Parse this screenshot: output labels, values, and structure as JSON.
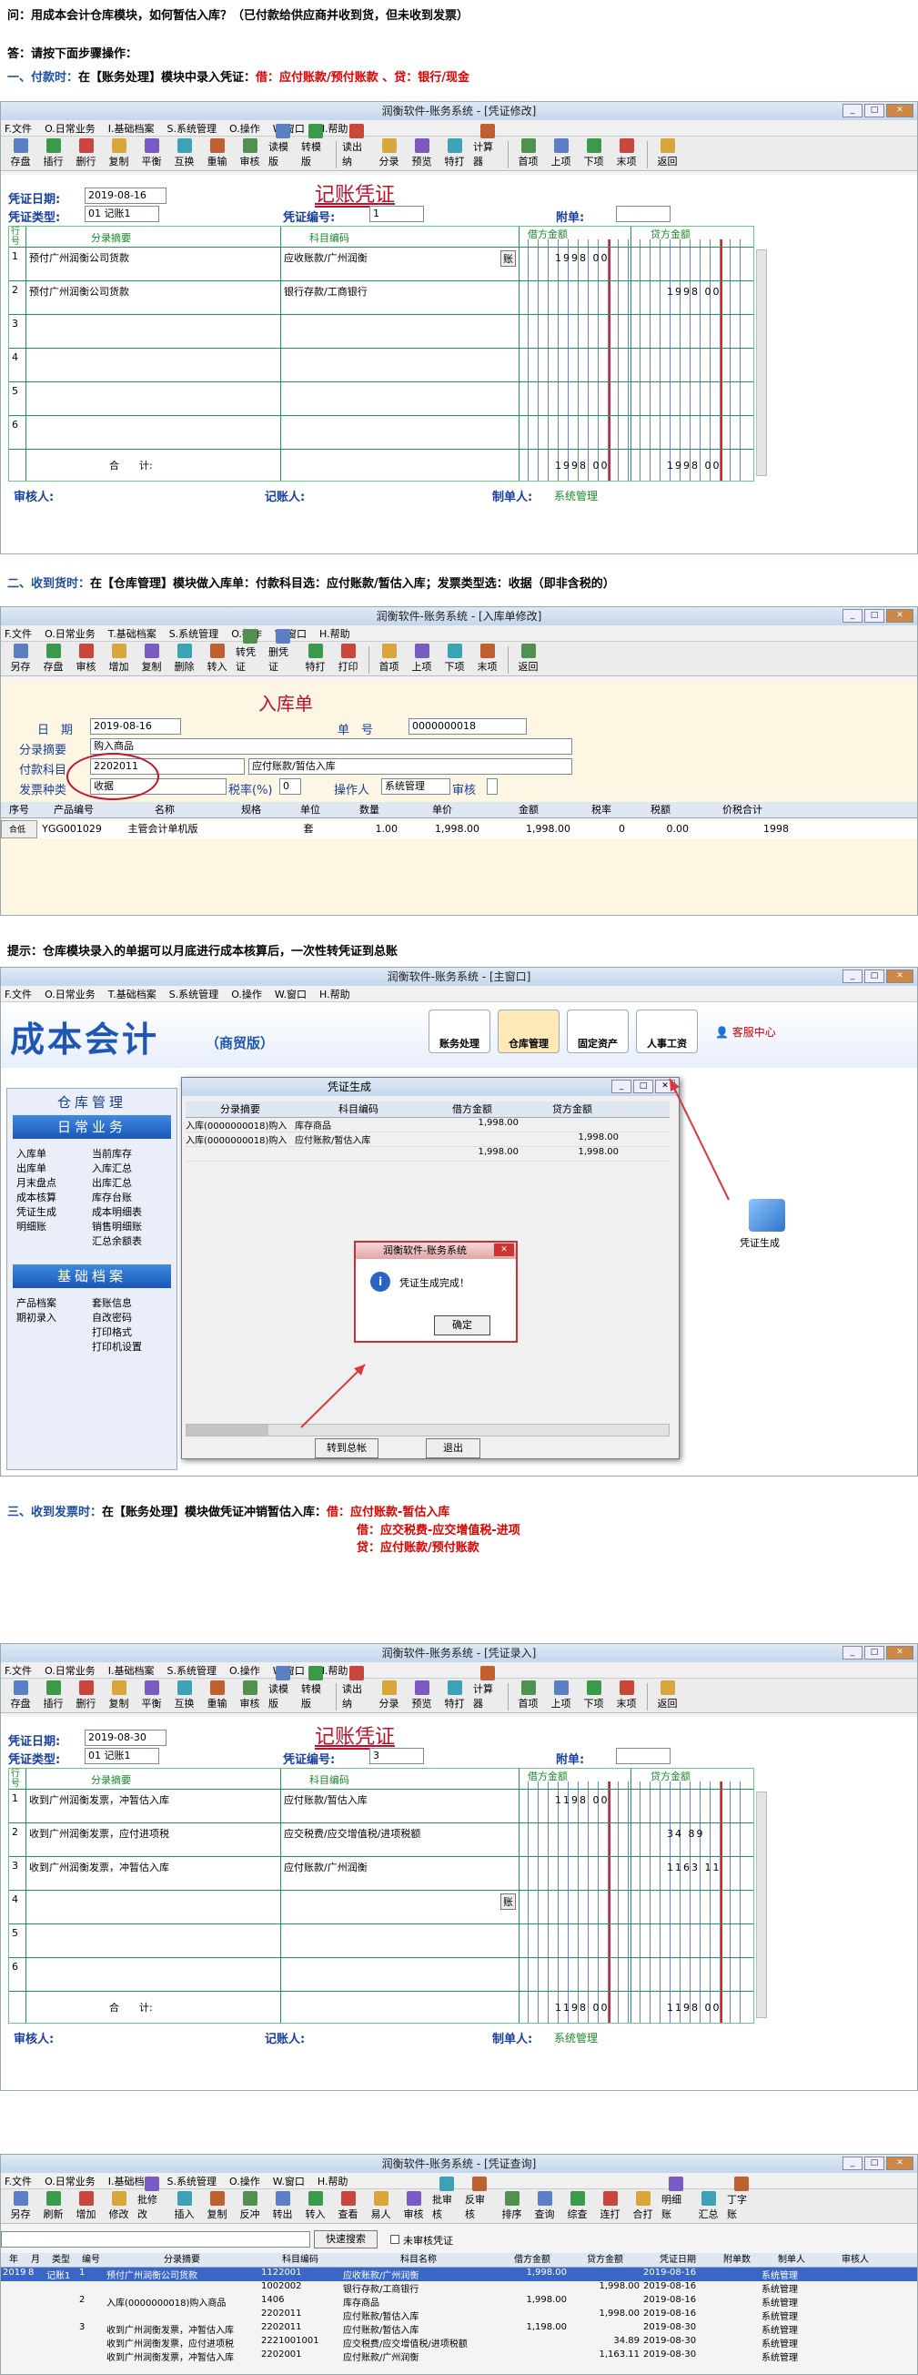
{
  "intro": {
    "question": "问：用成本会计仓库模块，如何暂估入库？（已付款给供应商并收到货，但未收到发票）",
    "answer": "答：请按下面步骤操作：",
    "step1_head": "一、付款时：",
    "step1_text": "在【账务处理】模块中录入凭证：",
    "step1_red": "借：应付账款/预付账款 、贷：银行/现金"
  },
  "win1": {
    "title": "润衡软件-账务系统 - [凭证修改]",
    "menu": [
      "F.文件",
      "O.日常业务",
      "I.基础档案",
      "S.系统管理",
      "O.操作",
      "W.窗口",
      "H.帮助"
    ],
    "toolbar": [
      "存盘",
      "插行",
      "删行",
      "复制",
      "平衡",
      "互换",
      "重输",
      "审核",
      "读模版",
      "转模版",
      "读出纳",
      "分录",
      "预览",
      "特打",
      "计算器",
      "首项",
      "上项",
      "下项",
      "末项",
      "返回"
    ],
    "voucher_title": "记账凭证",
    "date_label": "凭证日期:",
    "date": "2019-08-16",
    "type_label": "凭证类型:",
    "type": "01 记账1",
    "no_label": "凭证编号:",
    "no": "1",
    "att_label": "附单:",
    "col_no": "行号",
    "col_summary": "分录摘要",
    "col_acct": "科目编码",
    "col_debit": "借方金额",
    "col_credit": "贷方金额",
    "rows": [
      {
        "n": "1",
        "summary": "预付广州润衡公司货款",
        "acct": "应收账款/广州润衡",
        "debit": "1998 00",
        "credit": ""
      },
      {
        "n": "2",
        "summary": "预付广州润衡公司货款",
        "acct": "银行存款/工商银行",
        "debit": "",
        "credit": "1998 00"
      },
      {
        "n": "3",
        "summary": "",
        "acct": "",
        "debit": "",
        "credit": ""
      },
      {
        "n": "4",
        "summary": "",
        "acct": "",
        "debit": "",
        "credit": ""
      },
      {
        "n": "5",
        "summary": "",
        "acct": "",
        "debit": "",
        "credit": ""
      },
      {
        "n": "6",
        "summary": "",
        "acct": "",
        "debit": "",
        "credit": ""
      }
    ],
    "acct_btn": "账",
    "total_label": "合　　计:",
    "total_debit": "1998 00",
    "total_credit": "1998 00",
    "reviewer": "审核人:",
    "bookkeeper": "记账人:",
    "maker": "制单人:",
    "maker_name": "系统管理"
  },
  "step2": {
    "head": "二、收到货时：",
    "text": "在【仓库管理】模块做入库单：付款科目选：应付账款/暂估入库；发票类型选：收据（即非含税的）"
  },
  "win2": {
    "title": "润衡软件-账务系统 - [入库单修改]",
    "menu": [
      "F.文件",
      "O.日常业务",
      "T.基础档案",
      "S.系统管理",
      "O.操作",
      "W.窗口",
      "H.帮助"
    ],
    "toolbar": [
      "另存",
      "存盘",
      "审核",
      "增加",
      "复制",
      "删除",
      "转入",
      "转凭证",
      "删凭证",
      "特打",
      "打印",
      "首项",
      "上项",
      "下项",
      "末项",
      "返回"
    ],
    "form_title": "入库单",
    "date_label": "日　期",
    "date": "2019-08-16",
    "billno_label": "单　号",
    "billno": "0000000018",
    "summary_label": "分录摘要",
    "summary": "购入商品",
    "pay_label": "付款科目",
    "pay_code": "2202011",
    "pay_name": "应付账款/暂估入库",
    "inv_label": "发票种类",
    "inv": "收据",
    "tax_label": "税率(%)",
    "tax": "0",
    "op_label": "操作人",
    "op": "系统管理",
    "audit_label": "审核",
    "cols": [
      "序号",
      "产品编号",
      "名称",
      "规格",
      "单位",
      "数量",
      "单价",
      "金额",
      "税率",
      "税额",
      "价税合计"
    ],
    "row": {
      "n": "合低",
      "code": "YGG001029",
      "name": "主管会计单机版",
      "spec": "",
      "unit": "套",
      "qty": "1.00",
      "price": "1,998.00",
      "amt": "1,998.00",
      "rate": "0",
      "tax": "0.00",
      "total": "1998"
    }
  },
  "tip": "提示：仓库模块录入的单据可以月底进行成本核算后，一次性转凭证到总账",
  "win3": {
    "title": "润衡软件-账务系统 - [主窗口]",
    "menu": [
      "F.文件",
      "O.日常业务",
      "T.基础档案",
      "S.系统管理",
      "O.操作",
      "W.窗口",
      "H.帮助"
    ],
    "logo": "成本会计",
    "logo_sub": "（商贸版）",
    "tabs": [
      "账务处理",
      "仓库管理",
      "固定资产",
      "人事工资"
    ],
    "service": "客服中心",
    "left_head": "仓库管理",
    "daily_head": "日常业务",
    "daily": [
      [
        "入库单",
        "当前库存"
      ],
      [
        "出库单",
        "入库汇总"
      ],
      [
        "月末盘点",
        "出库汇总"
      ],
      [
        "成本核算",
        "库存台账"
      ],
      [
        "凭证生成",
        "成本明细表"
      ],
      [
        "明细账",
        "销售明细账"
      ],
      [
        "",
        "汇总余额表"
      ]
    ],
    "base_head": "基础档案",
    "base": [
      [
        "产品档案",
        "套账信息"
      ],
      [
        "期初录入",
        "自改密码"
      ],
      [
        "",
        "打印格式"
      ],
      [
        "",
        "打印机设置"
      ]
    ],
    "dialog_title": "凭证生成",
    "dcols": [
      "分录摘要",
      "科目编码",
      "借方金额",
      "贷方金额"
    ],
    "drows": [
      {
        "s": "入库(0000000018)购入商品",
        "c": "库存商品",
        "d": "1,998.00",
        "k": ""
      },
      {
        "s": "入库(0000000018)购入商品",
        "c": "应付账款/暂估入库",
        "d": "",
        "k": "1,998.00"
      },
      {
        "s": "",
        "c": "",
        "d": "1,998.00",
        "k": "1,998.00"
      }
    ],
    "btn_transfer": "转到总帐",
    "btn_exit": "退出",
    "msg_title": "润衡软件-账务系统",
    "msg_text": "凭证生成完成！",
    "msg_ok": "确定",
    "side_icon_label": "凭证生成"
  },
  "step3": {
    "head": "三、收到发票时：",
    "text": "在【账务处理】模块做凭证冲销暂估入库：",
    "l1": "借：应付账款-暂估入库",
    "l2": "借：应交税费-应交增值税-进项",
    "l3": "贷：应付账款/预付账款"
  },
  "win4": {
    "title": "润衡软件-账务系统 - [凭证录入]",
    "menu": [
      "F.文件",
      "O.日常业务",
      "I.基础档案",
      "S.系统管理",
      "O.操作",
      "W.窗口",
      "H.帮助"
    ],
    "toolbar": [
      "存盘",
      "插行",
      "删行",
      "复制",
      "平衡",
      "互换",
      "重输",
      "审核",
      "读模版",
      "转模版",
      "读出纳",
      "分录",
      "预览",
      "特打",
      "计算器",
      "首项",
      "上项",
      "下项",
      "末项",
      "返回"
    ],
    "voucher_title": "记账凭证",
    "date_label": "凭证日期:",
    "date": "2019-08-30",
    "type_label": "凭证类型:",
    "type": "01 记账1",
    "no_label": "凭证编号:",
    "no": "3",
    "att_label": "附单:",
    "col_no": "行号",
    "col_summary": "分录摘要",
    "col_acct": "科目编码",
    "col_debit": "借方金额",
    "col_credit": "贷方金额",
    "rows": [
      {
        "n": "1",
        "summary": "收到广州润衡发票，冲暂估入库",
        "acct": "应付账款/暂估入库",
        "debit": "1198 00",
        "credit": ""
      },
      {
        "n": "2",
        "summary": "收到广州润衡发票，应付进项税",
        "acct": "应交税费/应交增值税/进项税额",
        "debit": "",
        "credit": "34 89"
      },
      {
        "n": "3",
        "summary": "收到广州润衡发票，冲暂估入库",
        "acct": "应付账款/广州润衡",
        "debit": "",
        "credit": "1163 11"
      },
      {
        "n": "4",
        "summary": "",
        "acct": "",
        "debit": "",
        "credit": ""
      },
      {
        "n": "5",
        "summary": "",
        "acct": "",
        "debit": "",
        "credit": ""
      },
      {
        "n": "6",
        "summary": "",
        "acct": "",
        "debit": "",
        "credit": ""
      }
    ],
    "acct_btn": "账",
    "total_label": "合　　计:",
    "total_debit": "1198 00",
    "total_credit": "1198 00",
    "reviewer": "审核人:",
    "bookkeeper": "记账人:",
    "maker": "制单人:",
    "maker_name": "系统管理"
  },
  "win5": {
    "title": "润衡软件-账务系统 - [凭证查询]",
    "menu": [
      "F.文件",
      "O.日常业务",
      "I.基础档案",
      "S.系统管理",
      "O.操作",
      "W.窗口",
      "H.帮助"
    ],
    "toolbar": [
      "另存",
      "刷新",
      "增加",
      "修改",
      "批修改",
      "插入",
      "复制",
      "反冲",
      "转出",
      "转入",
      "查看",
      "易人",
      "审核",
      "批审核",
      "反审核",
      "排序",
      "查询",
      "综查",
      "连打",
      "合打",
      "明细账",
      "汇总",
      "丁字账"
    ],
    "search_btn": "快速搜索",
    "unaudit": "未审核凭证",
    "cols": [
      "年",
      "月",
      "类型",
      "编号",
      "分录摘要",
      "科目编码",
      "科目名称",
      "借方金额",
      "贷方金额",
      "凭证日期",
      "附单数",
      "制单人",
      "审核人"
    ],
    "rows": [
      {
        "y": "2019",
        "m": "8",
        "t": "记账1",
        "no": "1",
        "s": "预付广州润衡公司货款",
        "c": "1122001",
        "n": "应收账款/广州润衡",
        "d": "1,998.00",
        "k": "",
        "dt": "2019-08-16",
        "a": "",
        "u": "系统管理",
        "r": "",
        "sel": true
      },
      {
        "y": "",
        "m": "",
        "t": "",
        "no": "",
        "s": "",
        "c": "1002002",
        "n": "银行存款/工商银行",
        "d": "",
        "k": "1,998.00",
        "dt": "2019-08-16",
        "a": "",
        "u": "系统管理",
        "r": ""
      },
      {
        "y": "",
        "m": "",
        "t": "",
        "no": "2",
        "s": "入库(0000000018)购入商品",
        "c": "1406",
        "n": "库存商品",
        "d": "1,998.00",
        "k": "",
        "dt": "2019-08-16",
        "a": "",
        "u": "系统管理",
        "r": ""
      },
      {
        "y": "",
        "m": "",
        "t": "",
        "no": "",
        "s": "",
        "c": "2202011",
        "n": "应付账款/暂估入库",
        "d": "",
        "k": "1,998.00",
        "dt": "2019-08-16",
        "a": "",
        "u": "系统管理",
        "r": ""
      },
      {
        "y": "",
        "m": "",
        "t": "",
        "no": "3",
        "s": "收到广州润衡发票，冲暂估入库",
        "c": "2202011",
        "n": "应付账款/暂估入库",
        "d": "1,198.00",
        "k": "",
        "dt": "2019-08-30",
        "a": "",
        "u": "系统管理",
        "r": ""
      },
      {
        "y": "",
        "m": "",
        "t": "",
        "no": "",
        "s": "收到广州润衡发票，应付进项税",
        "c": "2221001001",
        "n": "应交税费/应交增值税/进项税额",
        "d": "",
        "k": "34.89",
        "dt": "2019-08-30",
        "a": "",
        "u": "系统管理",
        "r": ""
      },
      {
        "y": "",
        "m": "",
        "t": "",
        "no": "",
        "s": "收到广州润衡发票，冲暂估入库",
        "c": "2202001",
        "n": "应付账款/广州润衡",
        "d": "",
        "k": "1,163.11",
        "dt": "2019-08-30",
        "a": "",
        "u": "系统管理",
        "r": ""
      }
    ]
  },
  "colors": {
    "red": "#e00000",
    "blue": "#1f4e9c",
    "green": "#1a8a2a",
    "voucher_title": "#c0102a"
  }
}
